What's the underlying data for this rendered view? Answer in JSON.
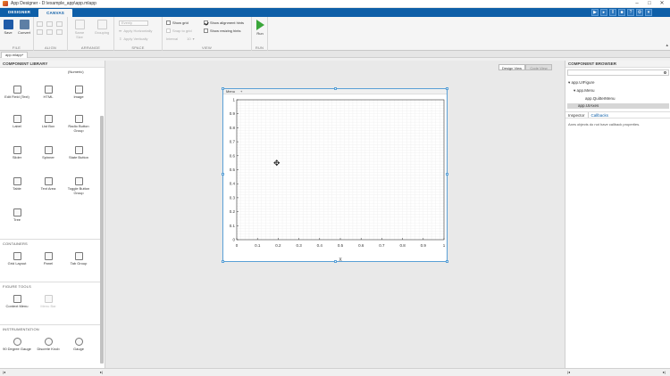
{
  "window": {
    "title": "App Designer - D:\\example_app\\app.mlapp",
    "controls": [
      "–",
      "□",
      "✕"
    ]
  },
  "tabs": [
    {
      "label": "DESIGNER",
      "active": false
    },
    {
      "label": "CANVAS",
      "active": true
    }
  ],
  "toolstrip": {
    "file": {
      "label": "FILE",
      "save": "Save",
      "convert": "Convert"
    },
    "align": {
      "label": "ALIGN"
    },
    "arrange": {
      "label": "ARRANGE",
      "same_size": "Same Size",
      "grouping": "Grouping"
    },
    "space": {
      "label": "SPACE",
      "evenly": "Evenly",
      "apply_horizontally": "Apply Horizontally",
      "apply_vertically": "Apply Vertically",
      "interval": "Interval",
      "interval_value": "10"
    },
    "view": {
      "label": "VIEW",
      "show_grid": "Show grid",
      "snap_to_grid": "Snap to grid",
      "show_alignment_hints": "Show alignment hints",
      "show_resizing_hints": "Show resizing hints",
      "show_grid_checked": false,
      "snap_to_grid_checked": false,
      "show_alignment_hints_checked": true,
      "show_resizing_hints_checked": false
    },
    "run": {
      "label": "RUN",
      "run": "Run"
    }
  },
  "document_tab": "app.mlapp*",
  "library": {
    "title": "COMPONENT LIBRARY",
    "top_partial": "(Numeric)",
    "components": [
      {
        "label": "Edit Field (Text)",
        "icon": "edit-field-icon"
      },
      {
        "label": "HTML",
        "icon": "html-icon"
      },
      {
        "label": "Image",
        "icon": "image-icon"
      },
      {
        "label": "Label",
        "icon": "label-icon"
      },
      {
        "label": "List Box",
        "icon": "list-box-icon"
      },
      {
        "label": "Radio Button Group",
        "icon": "radio-group-icon"
      },
      {
        "label": "Slider",
        "icon": "slider-icon"
      },
      {
        "label": "Spinner",
        "icon": "spinner-icon"
      },
      {
        "label": "State Button",
        "icon": "state-button-icon"
      },
      {
        "label": "Table",
        "icon": "table-icon"
      },
      {
        "label": "Text Area",
        "icon": "text-area-icon"
      },
      {
        "label": "Toggle Button Group",
        "icon": "toggle-group-icon"
      },
      {
        "label": "Tree",
        "icon": "tree-icon"
      }
    ],
    "containers_title": "CONTAINERS",
    "containers": [
      {
        "label": "Grid Layout",
        "icon": "grid-layout-icon"
      },
      {
        "label": "Panel",
        "icon": "panel-icon"
      },
      {
        "label": "Tab Group",
        "icon": "tab-group-icon"
      }
    ],
    "figure_tools_title": "FIGURE TOOLS",
    "figure_tools": [
      {
        "label": "Context Menu",
        "icon": "context-menu-icon",
        "disabled": false
      },
      {
        "label": "Menu Bar",
        "icon": "menu-bar-icon",
        "disabled": true
      }
    ],
    "instrumentation_title": "INSTRUMENTATION",
    "instrumentation": [
      {
        "label": "90 Degree Gauge",
        "icon": "ninety-degree-gauge-icon"
      },
      {
        "label": "Discrete Knob",
        "icon": "discrete-knob-icon"
      },
      {
        "label": "Gauge",
        "icon": "gauge-icon"
      }
    ]
  },
  "canvas": {
    "design_view": "Design View",
    "code_view": "Code View",
    "figure_menu": [
      "Menu",
      "+"
    ],
    "axes": {
      "xlabel": "X",
      "ticks": [
        "0",
        "0.1",
        "0.2",
        "0.3",
        "0.4",
        "0.5",
        "0.6",
        "0.7",
        "0.8",
        "0.9",
        "1"
      ]
    }
  },
  "browser": {
    "title": "COMPONENT BROWSER",
    "tree": [
      {
        "label": "app.UIFigure",
        "level": 0,
        "expanded": true
      },
      {
        "label": "app.Menu",
        "level": 1,
        "expanded": true
      },
      {
        "label": "app.QuitterMenu",
        "level": 2
      },
      {
        "label": "app.UIAxes",
        "level": 1,
        "selected": true
      }
    ],
    "inspector": "Inspector",
    "callbacks": "Callbacks",
    "note": "Axes objects do not have callback properties."
  },
  "colors": {
    "accent": "#0e5fa8",
    "selection": "#5aa0d6"
  }
}
